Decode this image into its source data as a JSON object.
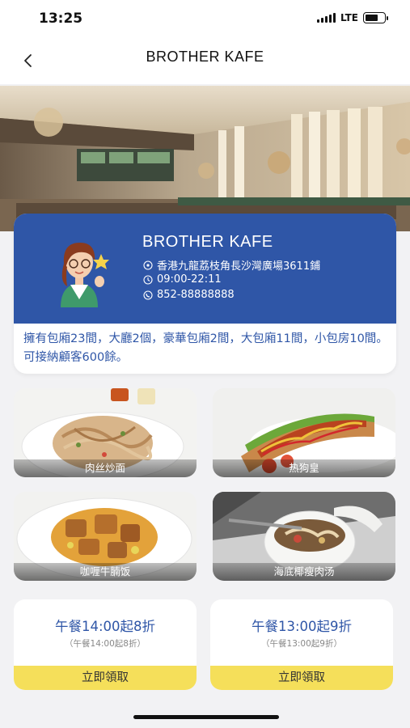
{
  "status_bar": {
    "time": "13:25",
    "network": "LTE"
  },
  "nav": {
    "title": "BROTHER KAFE",
    "back_icon": "chevron-left-icon"
  },
  "store": {
    "name": "BROTHER KAFE",
    "address": "香港九龍荔枝角長沙灣廣場3611鋪",
    "hours": "09:00-22:11",
    "phone": "852-88888888",
    "description": "擁有包廂23間，大廳2個，豪華包廂2間，大包廂11間，小包房10間。 可接納顧客600餘。"
  },
  "dishes": [
    {
      "name": "肉丝炒面"
    },
    {
      "name": "热狗皇"
    },
    {
      "name": "咖喱牛腩饭"
    },
    {
      "name": "海底椰瘦肉汤"
    }
  ],
  "coupons": [
    {
      "title": "午餐14:00起8折",
      "subtitle": "（午餐14:00起8折）",
      "button": "立即領取"
    },
    {
      "title": "午餐13:00起9折",
      "subtitle": "（午餐13:00起9折）",
      "button": "立即領取"
    }
  ],
  "colors": {
    "brand_blue": "#2f56a7",
    "coupon_yellow": "#f5df5a"
  }
}
